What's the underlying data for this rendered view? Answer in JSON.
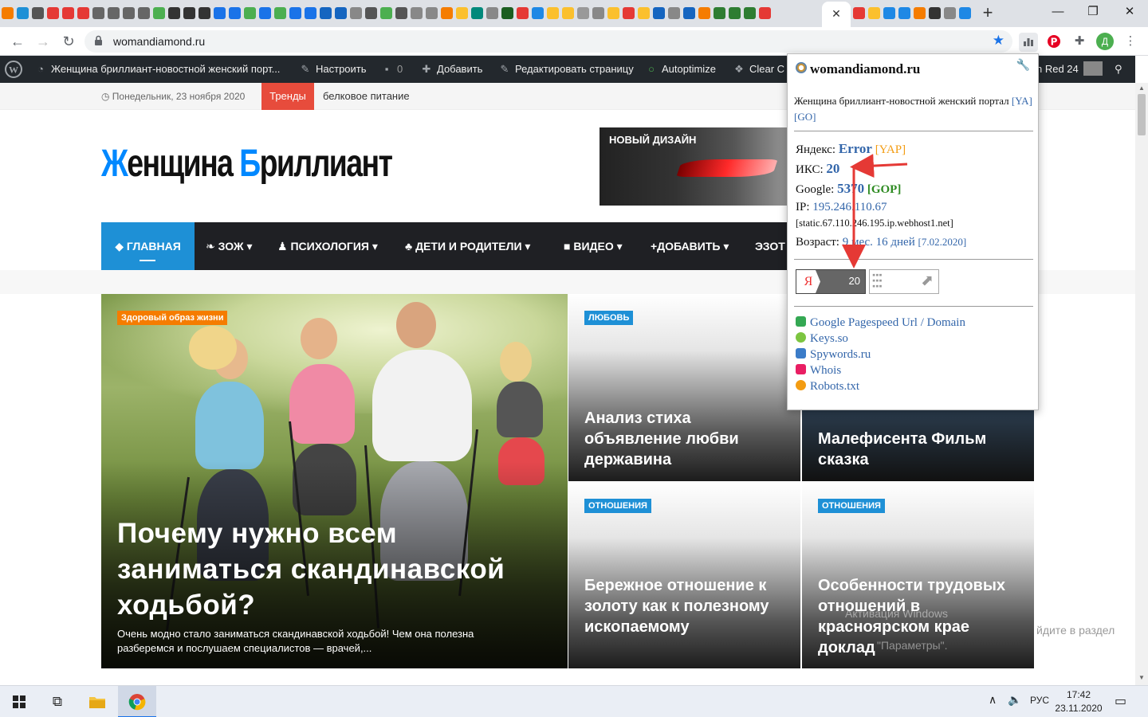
{
  "browser": {
    "url": "womandiamond.ru",
    "tab_close": "✕",
    "new_tab": "+",
    "controls": {
      "minimize": "—",
      "maximize": "❐",
      "close": "✕"
    },
    "nav": {
      "back": "←",
      "forward": "→",
      "reload": "↻"
    },
    "profile_initial": "Д"
  },
  "wp_admin_bar": {
    "site_title": "Женщина бриллиант-новостной женский порт...",
    "customize": "Настроить",
    "comments": "0",
    "add_new": "Добавить",
    "edit_page": "Редактировать страницу",
    "autoptimize": "Autoptimize",
    "clear_cache": "Clear C",
    "account": "n Red 24"
  },
  "topbar": {
    "date": "◷ Понедельник, 23 ноября 2020",
    "trends_label": "Тренды",
    "trend_link": "белковое питание"
  },
  "logo": {
    "part1_cap": "Ж",
    "part1_rest": "енщина ",
    "part2_cap": "Б",
    "part2_rest": "риллиант"
  },
  "ad": {
    "text": "НОВЫЙ ДИЗАЙН"
  },
  "menu": [
    {
      "label": "ГЛАВНАЯ",
      "icon": "◆"
    },
    {
      "label": "ЗОЖ ▾",
      "icon": "❧"
    },
    {
      "label": "ПСИХОЛОГИЯ ▾",
      "icon": "♟"
    },
    {
      "label": "ДЕТИ И РОДИТЕЛИ ▾",
      "icon": "♣"
    },
    {
      "label": "ВИДЕО ▾",
      "icon": "■"
    },
    {
      "label": "+ДОБАВИТЬ ▾",
      "icon": ""
    },
    {
      "label": "ЭЗОТ",
      "icon": ""
    }
  ],
  "main_post": {
    "category": "Здоровый образ жизни",
    "title": "Почему нужно всем заниматься скандинавской ходьбой?",
    "excerpt": "Очень модно стало заниматься скандинавской ходьбой! Чем она полезна разберемся и послушаем специалистов — врачей,..."
  },
  "cards": [
    {
      "category": "ЛЮБОВЬ",
      "title": "Анализ стиха объявление любви державина"
    },
    {
      "category": "",
      "title": "Малефисента Фильм сказка"
    },
    {
      "category": "ОТНОШЕНИЯ",
      "title": "Бережное отношение к золоту как к полезному ископаемому"
    },
    {
      "category": "ОТНОШЕНИЯ",
      "title": "Особенности трудовых отношений в красноярском крае доклад"
    }
  ],
  "windows_watermark": {
    "line1": "Активация Windows",
    "line2": "йдите в раздел",
    "line3": "\"Параметры\"."
  },
  "popup": {
    "domain": "womandiamond.ru",
    "description": "Женщина бриллиант-новостной женский портал",
    "ya_link": "[YA]",
    "go_link": "[GO]",
    "yandex_label": "Яндекс:",
    "yandex_value": "Error",
    "yap_link": "[YAP]",
    "iks_label": "ИКС:",
    "iks_value": "20",
    "google_label": "Google:",
    "google_value": "5370",
    "gop_link": "[GOP]",
    "ip_label": "IP:",
    "ip_value": "195.246.110.67",
    "host": "[static.67.110.246.195.ip.webhost1.net]",
    "age_label": "Возраст:",
    "age_value": "9 мес. 16 дней",
    "age_date": "[7.02.2020]",
    "yx_badge_letter": "Я",
    "yx_badge_value": "20",
    "links": [
      {
        "label": "Google Pagespeed Url / Domain",
        "icon": "pagespeed-icon",
        "color": "#34a853"
      },
      {
        "label": "Keys.so",
        "icon": "keys-icon",
        "color": "#7cc540"
      },
      {
        "label": "Spywords.ru",
        "icon": "spywords-icon",
        "color": "#3b7cc8"
      },
      {
        "label": "Whois",
        "icon": "whois-icon",
        "color": "#e91e63"
      },
      {
        "label": "Robots.txt",
        "icon": "robots-icon",
        "color": "#f39c12"
      }
    ]
  },
  "taskbar": {
    "lang": "РУС",
    "time": "17:42",
    "date": "23.11.2020"
  },
  "colors": {
    "accent": "#1e90d6",
    "trend": "#e74c3c",
    "category_orange": "#f57c00",
    "annotation_arrow": "#e53935"
  }
}
